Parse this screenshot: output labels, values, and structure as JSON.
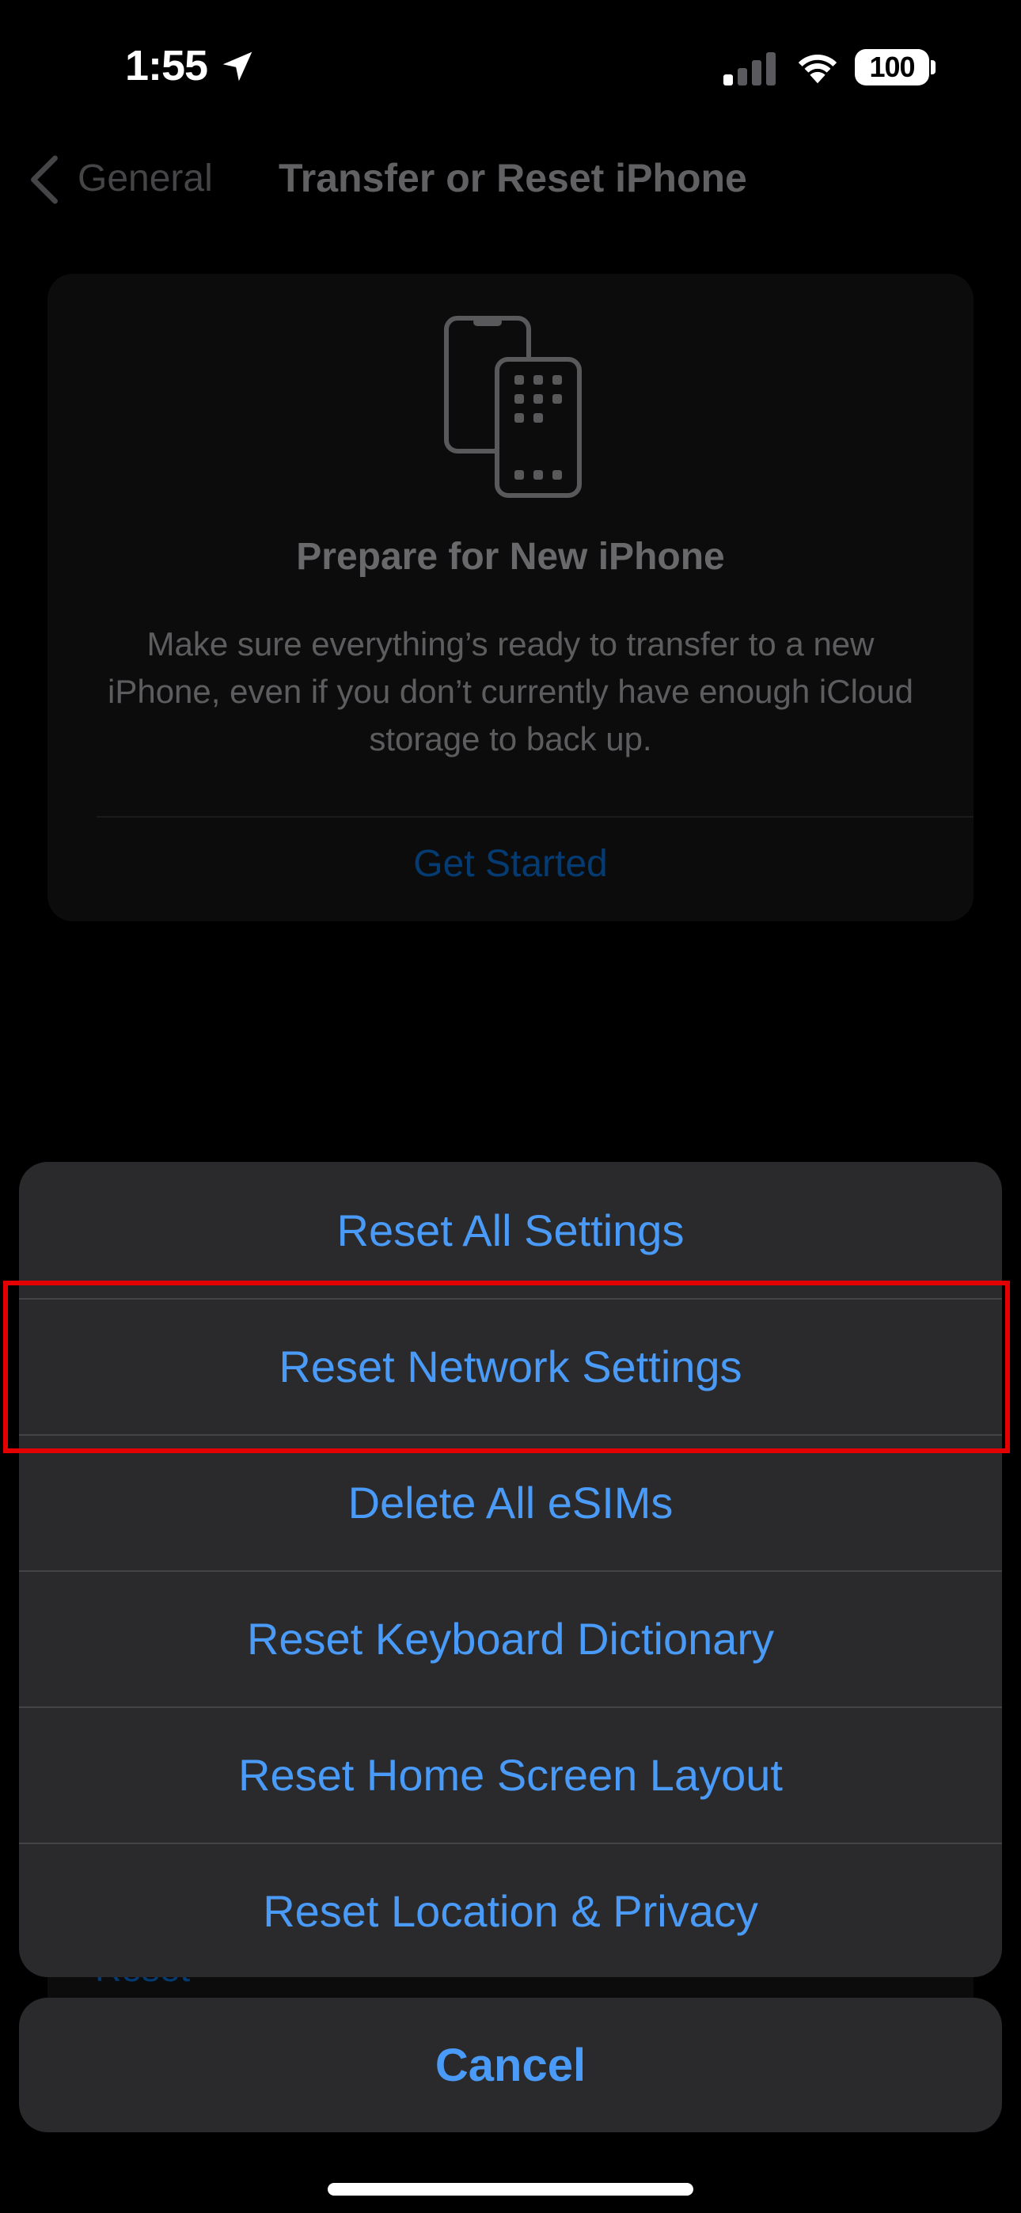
{
  "status_bar": {
    "time": "1:55",
    "battery": "100",
    "icons": [
      "location-arrow-icon",
      "cellular-signal-icon",
      "wifi-icon",
      "battery-icon"
    ]
  },
  "nav": {
    "back_label": "General",
    "title": "Transfer or Reset iPhone"
  },
  "prepare_card": {
    "icon": "phones-transfer-icon",
    "title": "Prepare for New iPhone",
    "description": "Make sure everything’s ready to transfer to a new iPhone, even if you don’t currently have enough iCloud storage to back up.",
    "button": "Get Started"
  },
  "reset_peek": {
    "label": "Reset"
  },
  "action_sheet": {
    "items": [
      {
        "label": "Reset All Settings"
      },
      {
        "label": "Reset Network Settings",
        "highlighted": true
      },
      {
        "label": "Delete All eSIMs"
      },
      {
        "label": "Reset Keyboard Dictionary"
      },
      {
        "label": "Reset Home Screen Layout"
      },
      {
        "label": "Reset Location & Privacy"
      }
    ],
    "cancel": "Cancel"
  },
  "colors": {
    "accent": "#4a9af7",
    "highlight": "#e30000",
    "sheet_background": "#2a2a2c"
  }
}
